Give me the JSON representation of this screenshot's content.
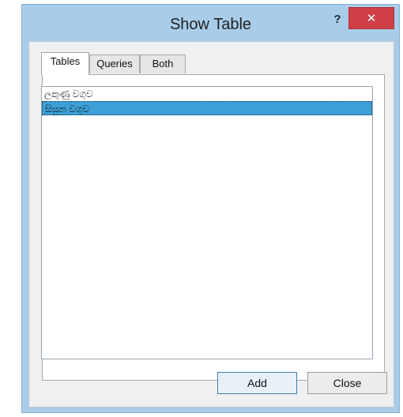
{
  "window": {
    "title": "Show Table",
    "help_glyph": "?",
    "close_glyph": "✕"
  },
  "tabs": [
    {
      "label": "Tables",
      "active": true
    },
    {
      "label": "Queries",
      "active": false
    },
    {
      "label": "Both",
      "active": false
    }
  ],
  "table_list": {
    "items": [
      {
        "label": "ලකුණු වගුව",
        "selected": false
      },
      {
        "label": "සිසුන වගුව",
        "selected": true
      }
    ]
  },
  "buttons": {
    "add_label": "Add",
    "close_label": "Close"
  },
  "colors": {
    "title_bar": "#a9cde9",
    "close_button": "#cf3f46",
    "selection": "#3e9fd6"
  }
}
